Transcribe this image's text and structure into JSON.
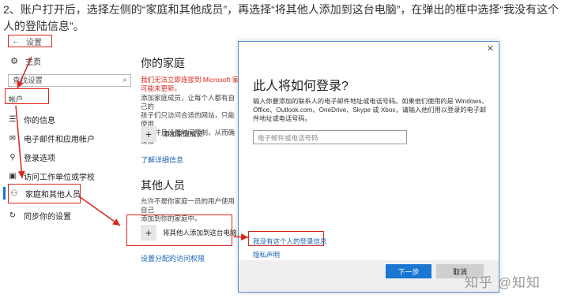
{
  "instruction": "2、账户打开后，选择左侧的“家庭和其他成员”，再选择“将其他人添加到这台电脑”，在弹出的框中选择“我没有这个人的登陆信息”。",
  "settings": {
    "back_glyph": "←",
    "title": "设置",
    "home_label": "主页",
    "search_placeholder": "查找设置",
    "category": "帐户",
    "nav_items": [
      {
        "icon": "person-card-icon",
        "glyph": "☰",
        "label": "你的信息"
      },
      {
        "icon": "mail-icon",
        "glyph": "✉",
        "label": "电子邮件和应用帐户"
      },
      {
        "icon": "key-icon",
        "glyph": "⚲",
        "label": "登录选项"
      },
      {
        "icon": "briefcase-icon",
        "glyph": "▣",
        "label": "访问工作单位或学校"
      },
      {
        "icon": "family-icon",
        "glyph": "⚇",
        "label": "家庭和其他人员"
      },
      {
        "icon": "sync-icon",
        "glyph": "↻",
        "label": "同步你的设置"
      }
    ],
    "selected_index": 4
  },
  "family": {
    "heading": "你的家庭",
    "warning": "我们无法立即连接到 Microsoft 家庭",
    "warning2": "可能未更新。",
    "description_lines": [
      "添加家庭成员，让每个人都有自己的",
      "孩子们只访问合适的网站，只能使用",
      "戏，并且设置时间限制，从而确保孩"
    ],
    "add_family_label": "添加家庭成员",
    "learn_more": "了解详细信息",
    "other_heading": "其他人员",
    "other_desc_lines": [
      "允许不是你家庭一员的用户使用自己",
      "添加到你的家庭中。"
    ],
    "add_other_label": "将其他人添加到这台电脑",
    "assigned_access": "设置分配的访问权限"
  },
  "dialog": {
    "close_glyph": "✕",
    "title": "此人将如何登录?",
    "description": "输入你要添加的联系人的电子邮件地址或电话号码。如果他们使用的是 Windows、Office、Outlook.com、OneDrive、Skype 或 Xbox，请输入他们用以登录的电子邮件地址或电话号码。",
    "input_placeholder": "电子邮件或电话号码",
    "no_info_link": "我没有这个人的登录信息",
    "privacy_link": "隐私声明",
    "next_button": "下一步",
    "cancel_button": "取消"
  },
  "watermark": "知乎 @知知",
  "colors": {
    "annotation_red": "#d9261c",
    "accent_blue": "#1977d2",
    "link_blue": "#1a62b5"
  }
}
